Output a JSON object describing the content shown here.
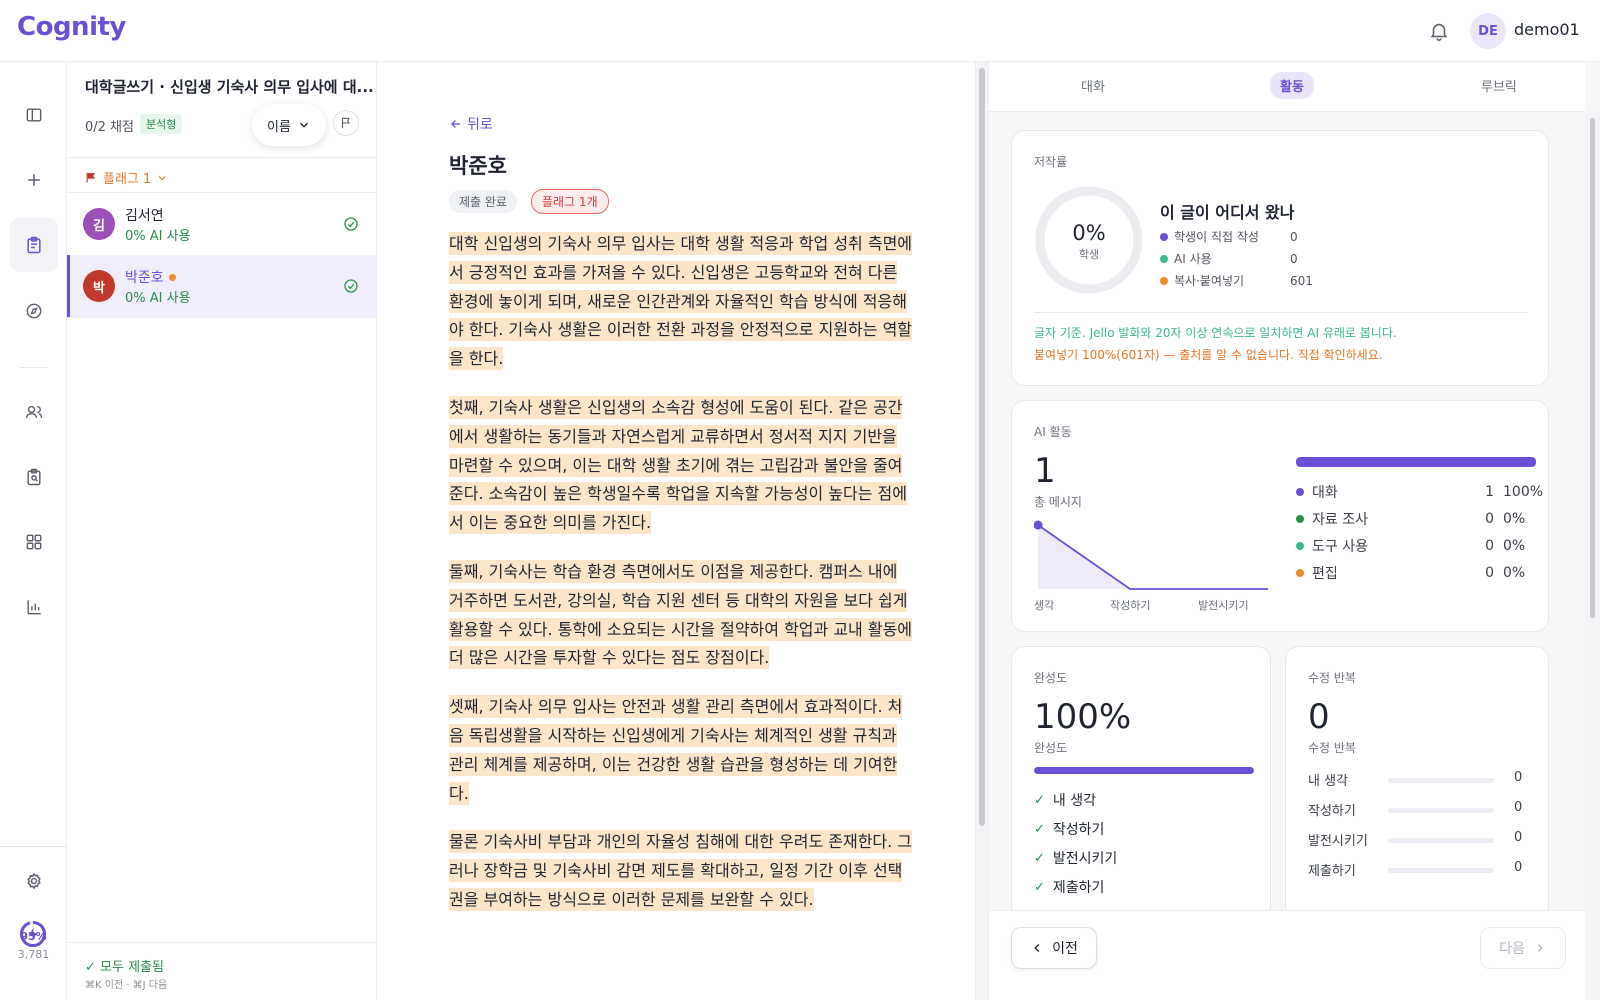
{
  "app": {
    "logo": "Cognity",
    "user_initials": "DE",
    "user_name": "demo01"
  },
  "rail": {
    "usage_pct": "95%",
    "usage_count": "3,781"
  },
  "list": {
    "title": "대학글쓰기 · 신입생 기숙사 의무 입사에 대...",
    "graded": "0/2 채점",
    "tag": "분석형",
    "sort_label": "이름",
    "flag_filter": "플래그 1",
    "students": [
      {
        "initial": "김",
        "name": "김서연",
        "ai": "0% AI 사용"
      },
      {
        "initial": "박",
        "name": "박준호",
        "ai": "0% AI 사용"
      }
    ],
    "all_submitted": "✓ 모두 제출됨",
    "shortcuts": "⌘K 이전 · ⌘J 다음"
  },
  "doc": {
    "back": "뒤로",
    "student_name": "박준호",
    "status_badge": "제출 완료",
    "flag_badge": "플래그 1개",
    "paragraphs": [
      "대학 신입생의 기숙사 의무 입사는 대학 생활 적응과 학업 성취 측면에서 긍정적인 효과를 가져올 수 있다. 신입생은 고등학교와 전혀 다른 환경에 놓이게 되며, 새로운 인간관계와 자율적인 학습 방식에 적응해야 한다. 기숙사 생활은 이러한 전환 과정을 안정적으로 지원하는 역할을 한다.",
      "첫째, 기숙사 생활은 신입생의 소속감 형성에 도움이 된다. 같은 공간에서 생활하는 동기들과 자연스럽게 교류하면서 정서적 지지 기반을 마련할 수 있으며, 이는 대학 생활 초기에 겪는 고립감과 불안을 줄여 준다. 소속감이 높은 학생일수록 학업을 지속할 가능성이 높다는 점에서 이는 중요한 의미를 가진다.",
      "둘째, 기숙사는 학습 환경 측면에서도 이점을 제공한다. 캠퍼스 내에 거주하면 도서관, 강의실, 학습 지원 센터 등 대학의 자원을 보다 쉽게 활용할 수 있다. 통학에 소요되는 시간을 절약하여 학업과 교내 활동에 더 많은 시간을 투자할 수 있다는 점도 장점이다.",
      "셋째, 기숙사 의무 입사는 안전과 생활 관리 측면에서 효과적이다. 처음 독립생활을 시작하는 신입생에게 기숙사는 체계적인 생활 규칙과 관리 체계를 제공하며, 이는 건강한 생활 습관을 형성하는 데 기여한다.",
      "물론 기숙사비 부담과 개인의 자율성 침해에 대한 우려도 존재한다. 그러나 장학금 및 기숙사비 감면 제도를 확대하고, 일정 기간 이후 선택권을 부여하는 방식으로 이러한 문제를 보완할 수 있다."
    ]
  },
  "panel": {
    "tabs": [
      "대화",
      "활동",
      "루브릭"
    ],
    "authorship": {
      "label": "저작률",
      "pct": "0%",
      "pct_sub": "학생",
      "heading": "이 글이 어디서 왔나",
      "rows": [
        {
          "label": "학생이 직접 작성",
          "value": "0",
          "color": "#6b4fd4"
        },
        {
          "label": "AI 사용",
          "value": "0",
          "color": "#3db88a"
        },
        {
          "label": "복사·붙여넣기",
          "value": "601",
          "color": "#ee8a2e"
        }
      ],
      "note1": "글자 기준. Jello 발화와 20자 이상 연속으로 일치하면 AI 유래로 봅니다.",
      "note2": "붙여넣기 100%(601자) — 출처를 알 수 없습니다. 직접 확인하세요."
    },
    "ai_activity": {
      "label": "AI 활동",
      "total": "1",
      "total_label": "총 메시지",
      "chart_x": [
        "생각",
        "작성하기",
        "발전시키기"
      ],
      "chart_values": [
        1,
        0,
        0
      ],
      "breakdown": [
        {
          "label": "대화",
          "count": "1",
          "pct": "100%",
          "color": "#6b4fd4"
        },
        {
          "label": "자료 조사",
          "count": "0",
          "pct": "0%",
          "color": "#2a9148"
        },
        {
          "label": "도구 사용",
          "count": "0",
          "pct": "0%",
          "color": "#3db88a"
        },
        {
          "label": "편집",
          "count": "0",
          "pct": "0%",
          "color": "#ee8a2e"
        }
      ],
      "bar_fill": 1.0
    },
    "completion": {
      "label": "완성도",
      "value": "100%",
      "sub": "완성도",
      "fill": 1.0,
      "steps": [
        "내 생각",
        "작성하기",
        "발전시키기",
        "제출하기"
      ]
    },
    "revisions": {
      "label": "수정 반복",
      "value": "0",
      "sub": "수정 반복",
      "rows": [
        {
          "label": "내 생각",
          "value": "0"
        },
        {
          "label": "작성하기",
          "value": "0"
        },
        {
          "label": "발전시키기",
          "value": "0"
        },
        {
          "label": "제출하기",
          "value": "0"
        }
      ]
    },
    "prev": "이전",
    "next": "다음"
  }
}
